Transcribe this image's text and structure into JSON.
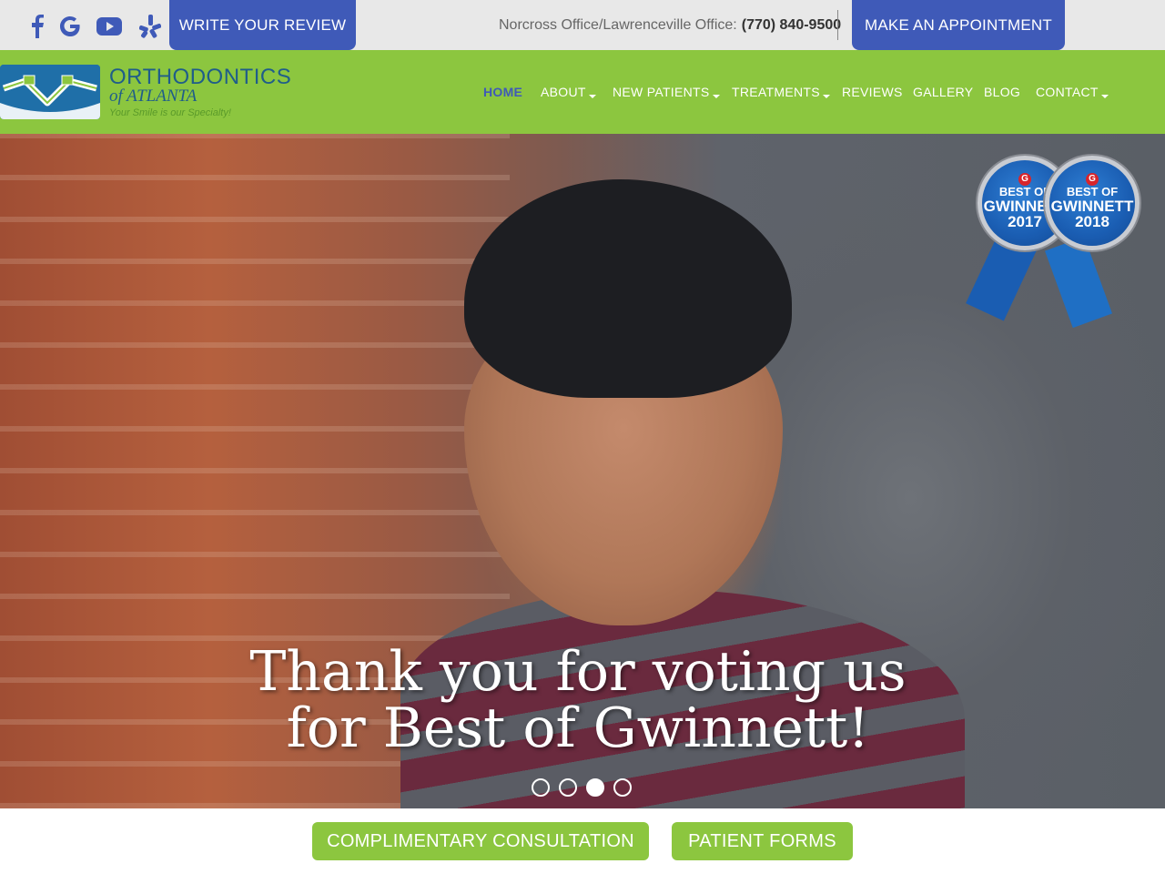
{
  "topbar": {
    "social": [
      {
        "name": "facebook-icon",
        "glyph": "f",
        "color": "#3f5ab8"
      },
      {
        "name": "google-icon",
        "glyph": "G",
        "color": "#3f5ab8"
      },
      {
        "name": "youtube-icon",
        "glyph": "▶",
        "color": "#3f5ab8"
      },
      {
        "name": "yelp-icon",
        "glyph": "✱",
        "color": "#3f5ab8"
      }
    ],
    "review_button": "WRITE YOUR REVIEW",
    "office_label": "Norcross Office/Lawrenceville Office:",
    "phone": "(770) 840-9500",
    "appointment_button": "MAKE AN APPOINTMENT"
  },
  "logo": {
    "title": "ORTHODONTICS",
    "subtitle": "of ATLANTA",
    "tagline": "Your Smile is our Specialty!"
  },
  "nav": {
    "items": [
      {
        "label": "HOME",
        "active": true,
        "dropdown": false
      },
      {
        "label": "ABOUT",
        "active": false,
        "dropdown": true
      },
      {
        "label": "NEW PATIENTS",
        "active": false,
        "dropdown": true
      },
      {
        "label": "TREATMENTS",
        "active": false,
        "dropdown": true
      },
      {
        "label": "REVIEWS",
        "active": false,
        "dropdown": false
      },
      {
        "label": "GALLERY",
        "active": false,
        "dropdown": false
      },
      {
        "label": "BLOG",
        "active": false,
        "dropdown": false
      },
      {
        "label": "CONTACT",
        "active": false,
        "dropdown": true
      }
    ]
  },
  "hero": {
    "line1": "Thank you for voting us",
    "line2": "for Best of Gwinnett!",
    "slides_total": 4,
    "active_slide": 3,
    "badges": [
      {
        "g": "G",
        "l1": "BEST OF",
        "l2": "GWINNETT",
        "l3": "2017"
      },
      {
        "g": "G",
        "l1": "BEST OF",
        "l2": "GWINNETT",
        "l3": "2018"
      }
    ]
  },
  "bottom": {
    "consultation_button": "COMPLIMENTARY CONSULTATION",
    "forms_button": "PATIENT FORMS"
  },
  "colors": {
    "brand_blue": "#3f5ab8",
    "brand_green": "#8cc63f",
    "topbar_bg": "#e8e8e8"
  }
}
